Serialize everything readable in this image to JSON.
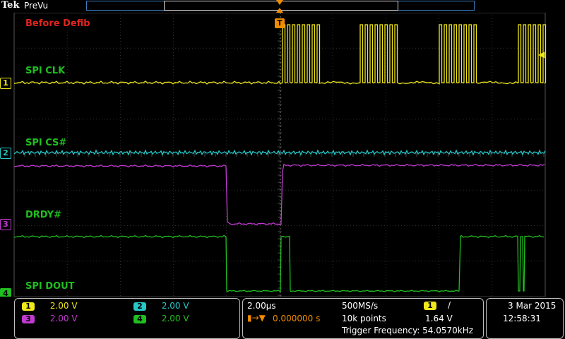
{
  "header": {
    "brand": "Tek",
    "mode": "PreVu"
  },
  "screen": {
    "title": "Before Defib",
    "labels": [
      {
        "text": "SPI CLK"
      },
      {
        "text": "SPI CS#"
      },
      {
        "text": "DRDY#"
      },
      {
        "text": "SPI DOUT"
      }
    ],
    "trigger_marker": "T",
    "channel_markers": [
      "1",
      "2",
      "3",
      "4"
    ]
  },
  "channels": [
    {
      "id": "1",
      "scale": "2.00 V",
      "color": "#f0e71c"
    },
    {
      "id": "2",
      "scale": "2.00 V",
      "color": "#27c8c8"
    },
    {
      "id": "3",
      "scale": "2.00 V",
      "color": "#c03ad0"
    },
    {
      "id": "4",
      "scale": "2.00 V",
      "color": "#1fbf1f"
    }
  ],
  "timebase": {
    "horizontal": "2.00µs",
    "sample_rate": "500MS/s",
    "position": "0.000000 s",
    "record": "10k points"
  },
  "trigger": {
    "source": "1",
    "slope": "/",
    "level": "1.64 V",
    "frequency": "Trigger Frequency: 54.0570kHz"
  },
  "datetime": {
    "date": "3 Mar  2015",
    "time": "12:58:31"
  },
  "colors": {
    "title": "#e0241e",
    "labels": "#1fbf1f",
    "grid": "#2f2f2f",
    "trigger": "#f08c00",
    "record_bar": "#3a7fc4"
  }
}
